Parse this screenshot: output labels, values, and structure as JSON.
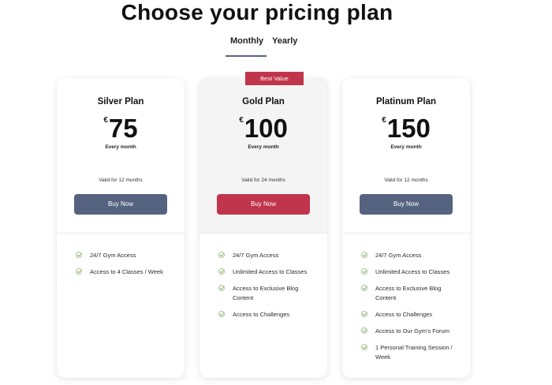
{
  "title": "Choose your pricing plan",
  "tabs": {
    "monthly": "Monthly",
    "yearly": "Yearly",
    "active": "Monthly"
  },
  "colors": {
    "slate_button": "#566380",
    "accent_red": "#c0354b",
    "check_green": "#8fb173"
  },
  "plans": [
    {
      "name": "Silver Plan",
      "currency": "€",
      "price": "75",
      "period": "Every month",
      "validity": "Valid for 12 months",
      "button_label": "Buy Now",
      "features": [
        "24/7 Gym Access",
        "Access to 4 Classes / Week"
      ]
    },
    {
      "badge": "Best Value",
      "name": "Gold Plan",
      "currency": "€",
      "price": "100",
      "period": "Every month",
      "validity": "Valid for 24 months",
      "button_label": "Buy Now",
      "features": [
        "24/7 Gym Access",
        "Unlimited Access to Classes",
        "Access to Exclusive Blog Content",
        "Access to Challenges"
      ]
    },
    {
      "name": "Platinum Plan",
      "currency": "€",
      "price": "150",
      "period": "Every month",
      "validity": "Valid for 12 months",
      "button_label": "Buy Now",
      "features": [
        "24/7 Gym Access",
        "Unlimited Access to Classes",
        "Access to Exclusive Blog Content",
        "Access to Challenges",
        "Access to Our Gym's Forum",
        "1 Personal Training Session / Week"
      ]
    }
  ]
}
